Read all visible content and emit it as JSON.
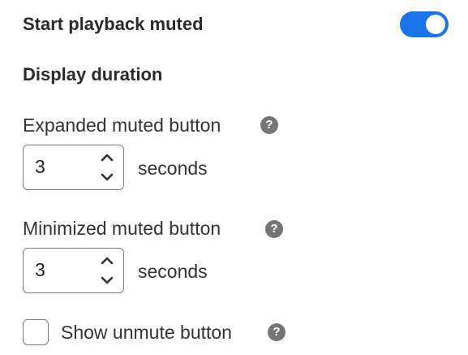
{
  "settings": {
    "start_muted": {
      "label": "Start playback muted",
      "enabled": true
    },
    "display_duration": {
      "heading": "Display duration",
      "expanded": {
        "label": "Expanded muted button",
        "value": "3",
        "unit": "seconds"
      },
      "minimized": {
        "label": "Minimized muted button",
        "value": "3",
        "unit": "seconds"
      }
    },
    "unmute": {
      "label": "Show unmute button",
      "checked": false
    }
  },
  "icons": {
    "help": "?",
    "help_color": "#757575",
    "toggle_on_color": "#1a73e8"
  }
}
